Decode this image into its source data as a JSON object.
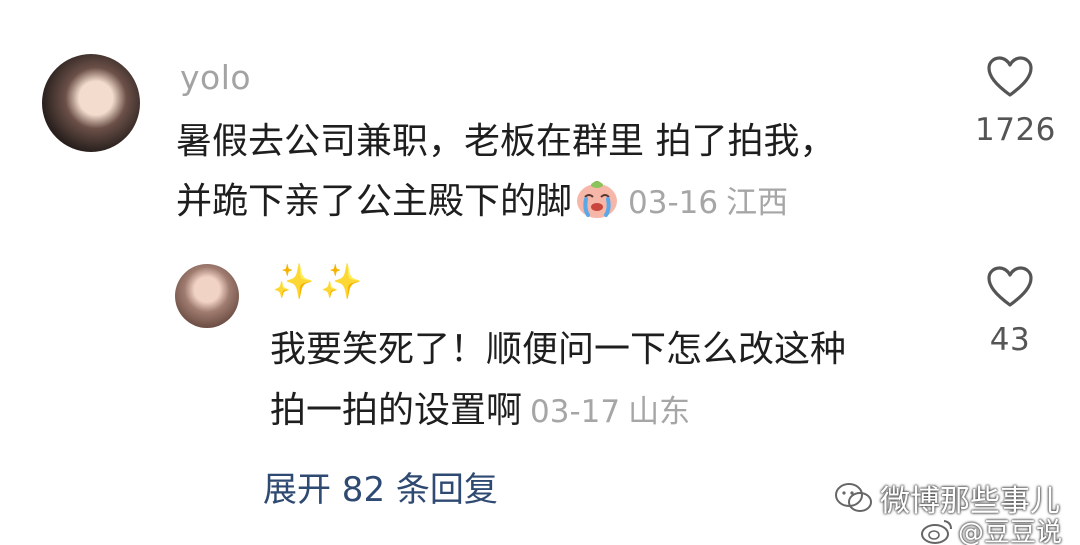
{
  "main_comment": {
    "username": "yolo",
    "line1": "暑假去公司兼职，老板在群里 拍了拍我，",
    "line2": "并跪下亲了公主殿下的脚",
    "emoji_icon": "crying-face-emoji",
    "date": "03-16",
    "location": "江西",
    "likes": "1726"
  },
  "reply_comment": {
    "username": "✨✨",
    "line1": "我要笑死了！顺便问一下怎么改这种",
    "line2": "拍一拍的设置啊",
    "date": "03-17",
    "location": "山东",
    "likes": "43"
  },
  "expand_label": "展开 82 条回复",
  "watermarks": {
    "wechat_account": "微博那些事儿",
    "weibo_account": "@豆豆说"
  },
  "colors": {
    "username": "#a3a3a3",
    "meta": "#a6a6a6",
    "link": "#2f4a72",
    "sparkle": "#f4c242"
  }
}
